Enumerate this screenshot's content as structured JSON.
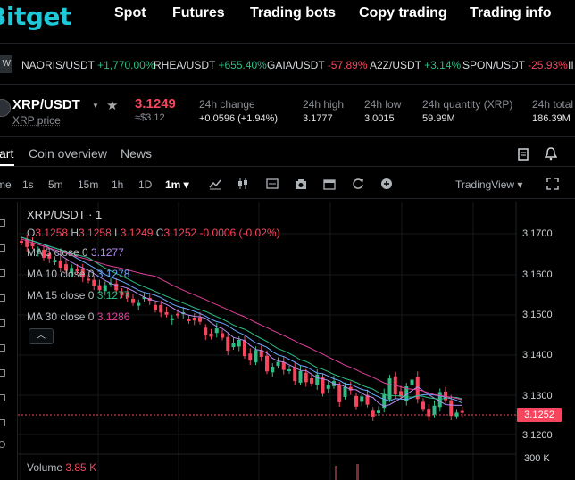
{
  "nav": {
    "logo": "Bitget",
    "items": [
      "Spot",
      "Futures",
      "Trading bots",
      "Copy trading",
      "Trading info"
    ]
  },
  "ticker": {
    "badge": "W",
    "items": [
      {
        "pair": "NAORIS/USDT",
        "change": "+1,770.00%",
        "dir": "up"
      },
      {
        "pair": "RHEA/USDT",
        "change": "+655.40%",
        "dir": "up"
      },
      {
        "pair": "GAIA/USDT",
        "change": "-57.89%",
        "dir": "down"
      },
      {
        "pair": "A2Z/USDT",
        "change": "+3.14%",
        "dir": "up"
      },
      {
        "pair": "SPON/USDT",
        "change": "-25.93%",
        "dir": "down"
      }
    ]
  },
  "pair": {
    "name": "XRP/USDT",
    "sub": "XRP price",
    "last_price": "3.1249",
    "last_usd": "≈$3.12",
    "stats": [
      {
        "label": "24h change",
        "value": "+0.0596 (+1.94%)",
        "dir": "up"
      },
      {
        "label": "24h high",
        "value": "3.1777"
      },
      {
        "label": "24h low",
        "value": "3.0015"
      },
      {
        "label": "24h quantity (XRP)",
        "value": "59.99M"
      },
      {
        "label": "24h total",
        "value": "186.39M"
      }
    ]
  },
  "tabs": [
    "art",
    "Coin overview",
    "News"
  ],
  "toolbar": {
    "intervals": [
      "me",
      "1s",
      "5m",
      "15m",
      "1h",
      "1D",
      "1m"
    ],
    "active_interval": "1m",
    "view": "TradingView"
  },
  "chart_header": {
    "title": "XRP/USDT · 1",
    "ohlc": {
      "o": "3.1258",
      "h": "3.1258",
      "l": "3.1249",
      "c": "3.1252",
      "chg": "-0.0006 (-0.02%)"
    },
    "ma": [
      {
        "label": "MA 5 close 0",
        "value": "3.1277",
        "color": "#b48cf0"
      },
      {
        "label": "MA 10 close 0",
        "value": "3.1278",
        "color": "#6ea8ff"
      },
      {
        "label": "MA 15 close 0",
        "value": "3.1277",
        "color": "#2ebd85"
      },
      {
        "label": "MA 30 close 0",
        "value": "3.1286",
        "color": "#e0409a"
      }
    ],
    "volume_label": "Volume",
    "volume_value": "3.85 K"
  },
  "y_axis": {
    "ticks": [
      "3.1700",
      "3.1600",
      "3.1500",
      "3.1400",
      "3.1300",
      "3.1200"
    ],
    "current": "3.1252",
    "volume_tick": "300 K"
  },
  "colors": {
    "up": "#2ebd85",
    "down": "#f6465d",
    "brand": "#1ec8d8"
  }
}
